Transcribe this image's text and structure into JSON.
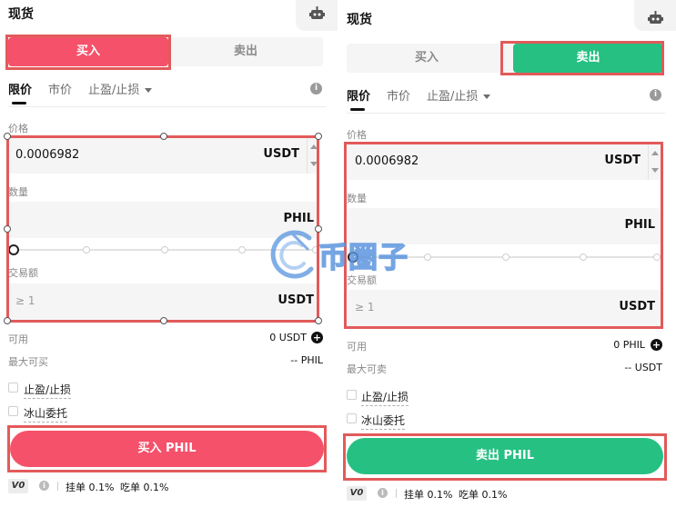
{
  "buy_panel": {
    "title": "现货",
    "tabs": {
      "buy": "买入",
      "sell": "卖出"
    },
    "order_types": {
      "limit": "限价",
      "market": "市价",
      "tpsl": "止盈/止损"
    },
    "price": {
      "label": "价格",
      "value": "0.0006982",
      "unit": "USDT"
    },
    "amount": {
      "label": "数量",
      "value": "",
      "unit": "PHIL"
    },
    "slider": {
      "fraction": 0
    },
    "total": {
      "label": "交易额",
      "placeholder": "≥ 1",
      "unit": "USDT"
    },
    "available": {
      "label": "可用",
      "value": "0 USDT"
    },
    "max": {
      "label": "最大可买",
      "value": "-- PHIL"
    },
    "checkbox_tpsl": "止盈/止损",
    "checkbox_iceberg": "冰山委托",
    "action": "买入 PHIL",
    "footer": {
      "vip": "V0",
      "maker": "挂单 0.1%",
      "taker": "吃单 0.1%"
    }
  },
  "sell_panel": {
    "title": "现货",
    "tabs": {
      "buy": "买入",
      "sell": "卖出"
    },
    "order_types": {
      "limit": "限价",
      "market": "市价",
      "tpsl": "止盈/止损"
    },
    "price": {
      "label": "价格",
      "value": "0.0006982",
      "unit": "USDT"
    },
    "amount": {
      "label": "数量",
      "value": "",
      "unit": "PHIL"
    },
    "slider": {
      "fraction": 0
    },
    "total": {
      "label": "交易额",
      "placeholder": "≥ 1",
      "unit": "USDT"
    },
    "available": {
      "label": "可用",
      "value": "0 PHIL"
    },
    "max": {
      "label": "最大可卖",
      "value": "-- USDT"
    },
    "checkbox_tpsl": "止盈/止损",
    "checkbox_iceberg": "冰山委托",
    "action": "卖出 PHIL",
    "footer": {
      "vip": "V0",
      "maker": "挂单 0.1%",
      "taker": "吃单 0.1%"
    }
  },
  "watermark": "币圈子",
  "colors": {
    "buy": "#f5516a",
    "sell": "#27c083",
    "highlight": "#e25a5a"
  },
  "icons": [
    "robot-icon",
    "info-icon",
    "plus-icon",
    "chevron-down-icon"
  ]
}
